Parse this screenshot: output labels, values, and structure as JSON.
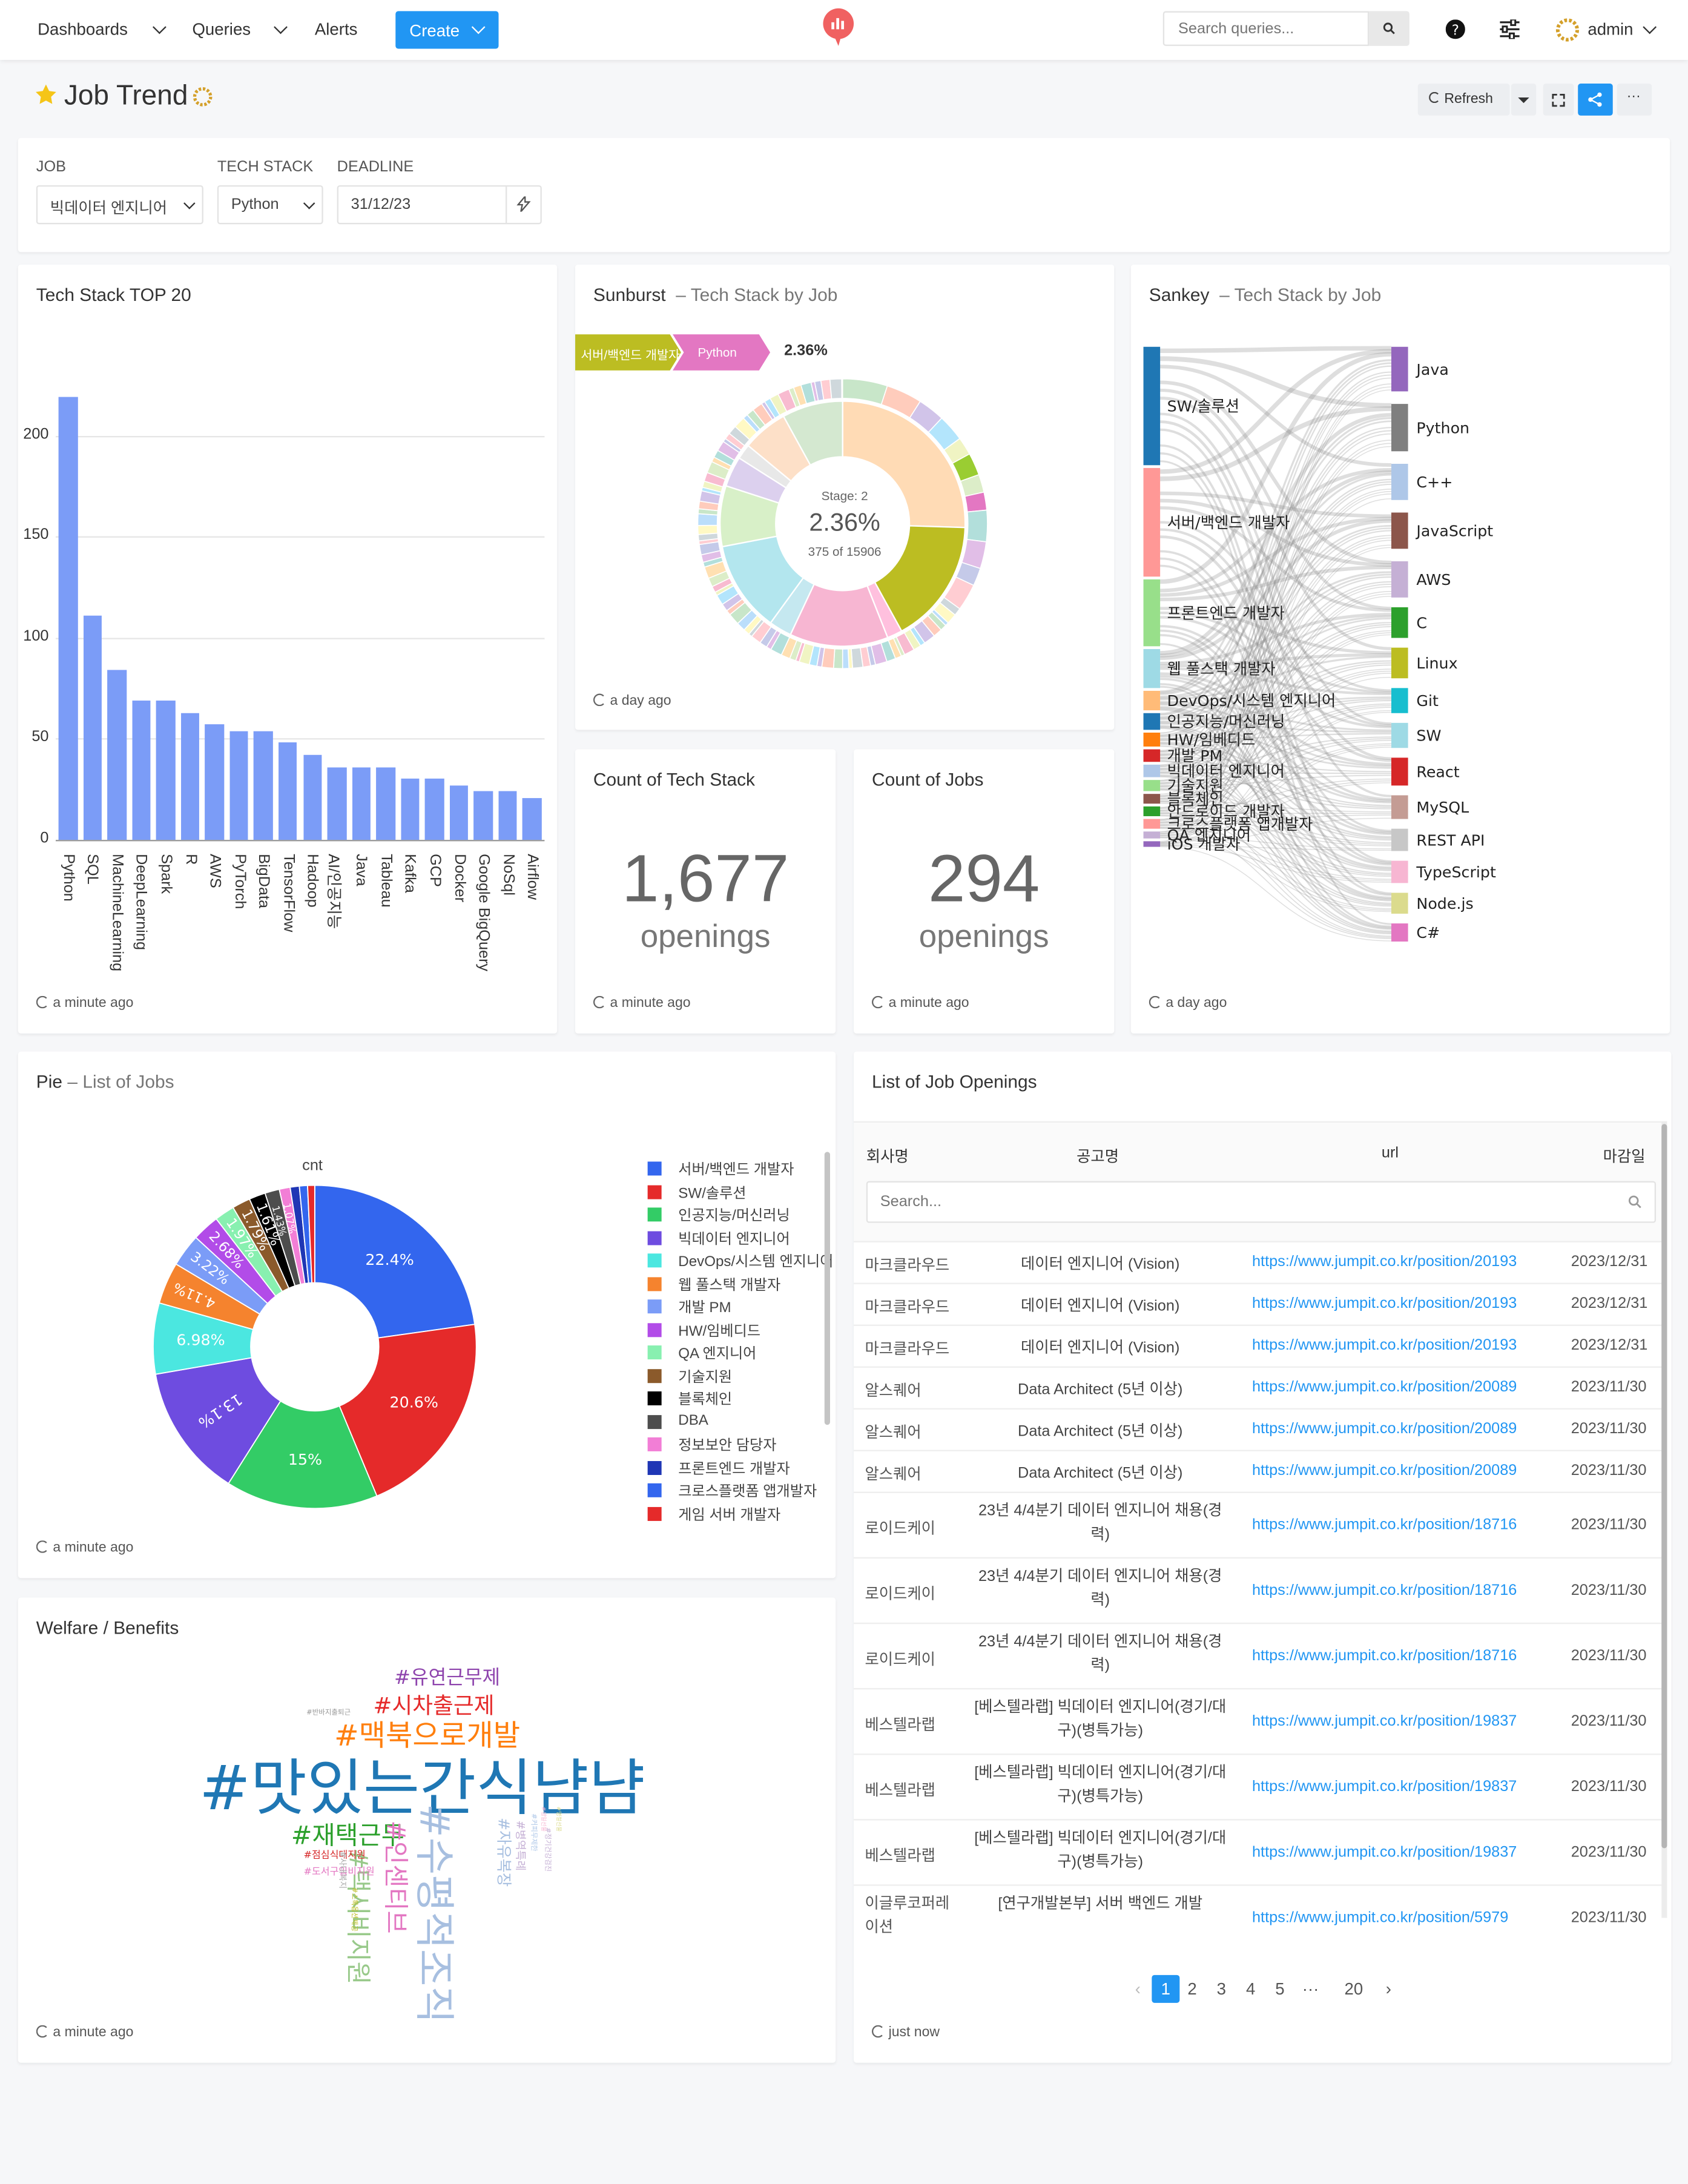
{
  "nav": {
    "dashboards": "Dashboards",
    "queries": "Queries",
    "alerts": "Alerts",
    "create": "Create",
    "search_placeholder": "Search queries...",
    "user": "admin"
  },
  "page": {
    "title": "Job Trend",
    "refresh": "Refresh"
  },
  "params": {
    "job_label": "JOB",
    "job_value": "빅데이터 엔지니어",
    "tech_label": "TECH STACK",
    "tech_value": "Python",
    "deadline_label": "DEADLINE",
    "deadline_value": "31/12/23"
  },
  "widgets": {
    "top20": {
      "title": "Tech Stack TOP 20",
      "updated": "a minute ago"
    },
    "sunburst": {
      "title": "Sunburst",
      "subtitle": "Tech Stack by Job",
      "crumb1": "서버/백엔드 개발자",
      "crumb2": "Python",
      "crumb_pct": "2.36%",
      "stage": "Stage: 2",
      "pct": "2.36%",
      "count": "375 of 15906",
      "updated": "a day ago"
    },
    "sankey": {
      "title": "Sankey",
      "subtitle": "Tech Stack by Job",
      "updated": "a day ago",
      "left": [
        "SW/솔루션",
        "서버/백엔드 개발자",
        "프론트엔드 개발자",
        "웹 풀스택 개발자",
        "DevOps/시스템 엔지니어",
        "인공지능/머신러닝",
        "HW/임베디드",
        "개발 PM",
        "빅데이터 엔지니어",
        "기술지원",
        "블록체인",
        "안드로이드 개발자",
        "크로스플랫폼 앱개발자",
        "QA 엔지니어",
        "iOS 개발자"
      ],
      "right": [
        "Java",
        "Python",
        "C++",
        "JavaScript",
        "AWS",
        "C",
        "Linux",
        "Git",
        "SW",
        "React",
        "MySQL",
        "REST API",
        "TypeScript",
        "Node.js",
        "C#"
      ]
    },
    "count_stack": {
      "title": "Count of Tech Stack",
      "value": "1,677",
      "unit": "openings",
      "updated": "a minute ago"
    },
    "count_jobs": {
      "title": "Count of Jobs",
      "value": "294",
      "unit": "openings",
      "updated": "a minute ago"
    },
    "pie": {
      "title": "Pie",
      "subtitle": "List of Jobs",
      "series_label": "cnt",
      "updated": "a minute ago",
      "legend": [
        "서버/백엔드 개발자",
        "SW/솔루션",
        "인공지능/머신러닝",
        "빅데이터 엔지니어",
        "DevOps/시스템 엔지니어",
        "웹 풀스택 개발자",
        "개발 PM",
        "HW/임베디드",
        "QA 엔지니어",
        "기술지원",
        "블록체인",
        "DBA",
        "정보보안 담당자",
        "프론트엔드 개발자",
        "크로스플랫폼 앱개발자",
        "게임 서버 개발자"
      ]
    },
    "welfare": {
      "title": "Welfare / Benefits",
      "updated": "a minute ago",
      "words": [
        "#유연근무제",
        "#시차출근제",
        "#맥북으로개발",
        "#맛있는간식냠냠",
        "#재택근무",
        "#인센티브",
        "#수평적조직",
        "#택시비지원",
        "#점심식대지원",
        "#도서구입비지원",
        "#병역특례",
        "#스톡옵션제공",
        "#사내복지",
        "#자유복장",
        "#반바지출퇴근",
        "#정기건강검진",
        "#커피무제한",
        "#생일선물",
        "#명절선물"
      ]
    },
    "openings": {
      "title": "List of Job Openings",
      "updated": "just now",
      "search_placeholder": "Search...",
      "columns": [
        "회사명",
        "공고명",
        "url",
        "마감일"
      ],
      "rows": [
        [
          "마크클라우드",
          "데이터 엔지니어 (Vision)",
          "https://www.jumpit.co.kr/position/20193",
          "2023/12/31"
        ],
        [
          "마크클라우드",
          "데이터 엔지니어 (Vision)",
          "https://www.jumpit.co.kr/position/20193",
          "2023/12/31"
        ],
        [
          "마크클라우드",
          "데이터 엔지니어 (Vision)",
          "https://www.jumpit.co.kr/position/20193",
          "2023/12/31"
        ],
        [
          "알스퀘어",
          "Data Architect (5년 이상)",
          "https://www.jumpit.co.kr/position/20089",
          "2023/11/30"
        ],
        [
          "알스퀘어",
          "Data Architect (5년 이상)",
          "https://www.jumpit.co.kr/position/20089",
          "2023/11/30"
        ],
        [
          "알스퀘어",
          "Data Architect (5년 이상)",
          "https://www.jumpit.co.kr/position/20089",
          "2023/11/30"
        ],
        [
          "로이드케이",
          "23년 4/4분기 데이터 엔지니어 채용(경력)",
          "https://www.jumpit.co.kr/position/18716",
          "2023/11/30"
        ],
        [
          "로이드케이",
          "23년 4/4분기 데이터 엔지니어 채용(경력)",
          "https://www.jumpit.co.kr/position/18716",
          "2023/11/30"
        ],
        [
          "로이드케이",
          "23년 4/4분기 데이터 엔지니어 채용(경력)",
          "https://www.jumpit.co.kr/position/18716",
          "2023/11/30"
        ],
        [
          "베스텔라랩",
          "[베스텔라랩] 빅데이터 엔지니어(경기/대구)(병특가능)",
          "https://www.jumpit.co.kr/position/19837",
          "2023/11/30"
        ],
        [
          "베스텔라랩",
          "[베스텔라랩] 빅데이터 엔지니어(경기/대구)(병특가능)",
          "https://www.jumpit.co.kr/position/19837",
          "2023/11/30"
        ],
        [
          "베스텔라랩",
          "[베스텔라랩] 빅데이터 엔지니어(경기/대구)(병특가능)",
          "https://www.jumpit.co.kr/position/19837",
          "2023/11/30"
        ],
        [
          "이글루코퍼레이션",
          "[연구개발본부] 서버 백엔드 개발",
          "https://www.jumpit.co.kr/position/5979",
          "2023/11/30"
        ]
      ],
      "pages": [
        "1",
        "2",
        "3",
        "4",
        "5",
        "···",
        "20"
      ]
    }
  },
  "chart_data": [
    {
      "type": "bar",
      "title": "Tech Stack TOP 20",
      "categories": [
        "Python",
        "SQL",
        "MachineLearning",
        "DeepLearning",
        "Spark",
        "R",
        "AWS",
        "PyTorch",
        "BigData",
        "TensorFlow",
        "Hadoop",
        "AI/인공지능",
        "Java",
        "Tableau",
        "Kafka",
        "GCP",
        "Docker",
        "Google BigQuery",
        "NoSql",
        "Airflow"
      ],
      "values": [
        219,
        111,
        84,
        69,
        69,
        63,
        57,
        54,
        54,
        48,
        42,
        36,
        36,
        36,
        30,
        30,
        27,
        24,
        24,
        21
      ],
      "ylim": [
        0,
        230
      ],
      "yticks": [
        0,
        50,
        100,
        150,
        200
      ],
      "color": "#7b9cf7"
    },
    {
      "type": "pie",
      "title": "List of Jobs",
      "series": "cnt",
      "values": [
        22.4,
        20.6,
        15,
        13.1,
        6.98,
        4.11,
        3.22,
        2.68,
        1.97,
        1.79,
        1.61,
        1.43,
        1.07,
        0.9,
        0.8,
        0.7
      ],
      "labels": [
        "22.4%",
        "20.6%",
        "15%",
        "13.1%",
        "6.98%",
        "4.11%",
        "3.22%",
        "2.68%",
        "1.97%",
        "1.79%",
        "1.61%",
        "1.43%",
        "1.07%",
        "",
        "",
        ""
      ],
      "colors": [
        "#3366ee",
        "#e52a2a",
        "#33cc66",
        "#6e4ce0",
        "#4be7e0",
        "#f5832e",
        "#7b9cf7",
        "#b24ce8",
        "#88f0b0",
        "#8b5a2b",
        "#000000",
        "#4d4d4d",
        "#f27ed6",
        "#1f36b5",
        "#3366ee",
        "#e52a2a"
      ]
    }
  ]
}
